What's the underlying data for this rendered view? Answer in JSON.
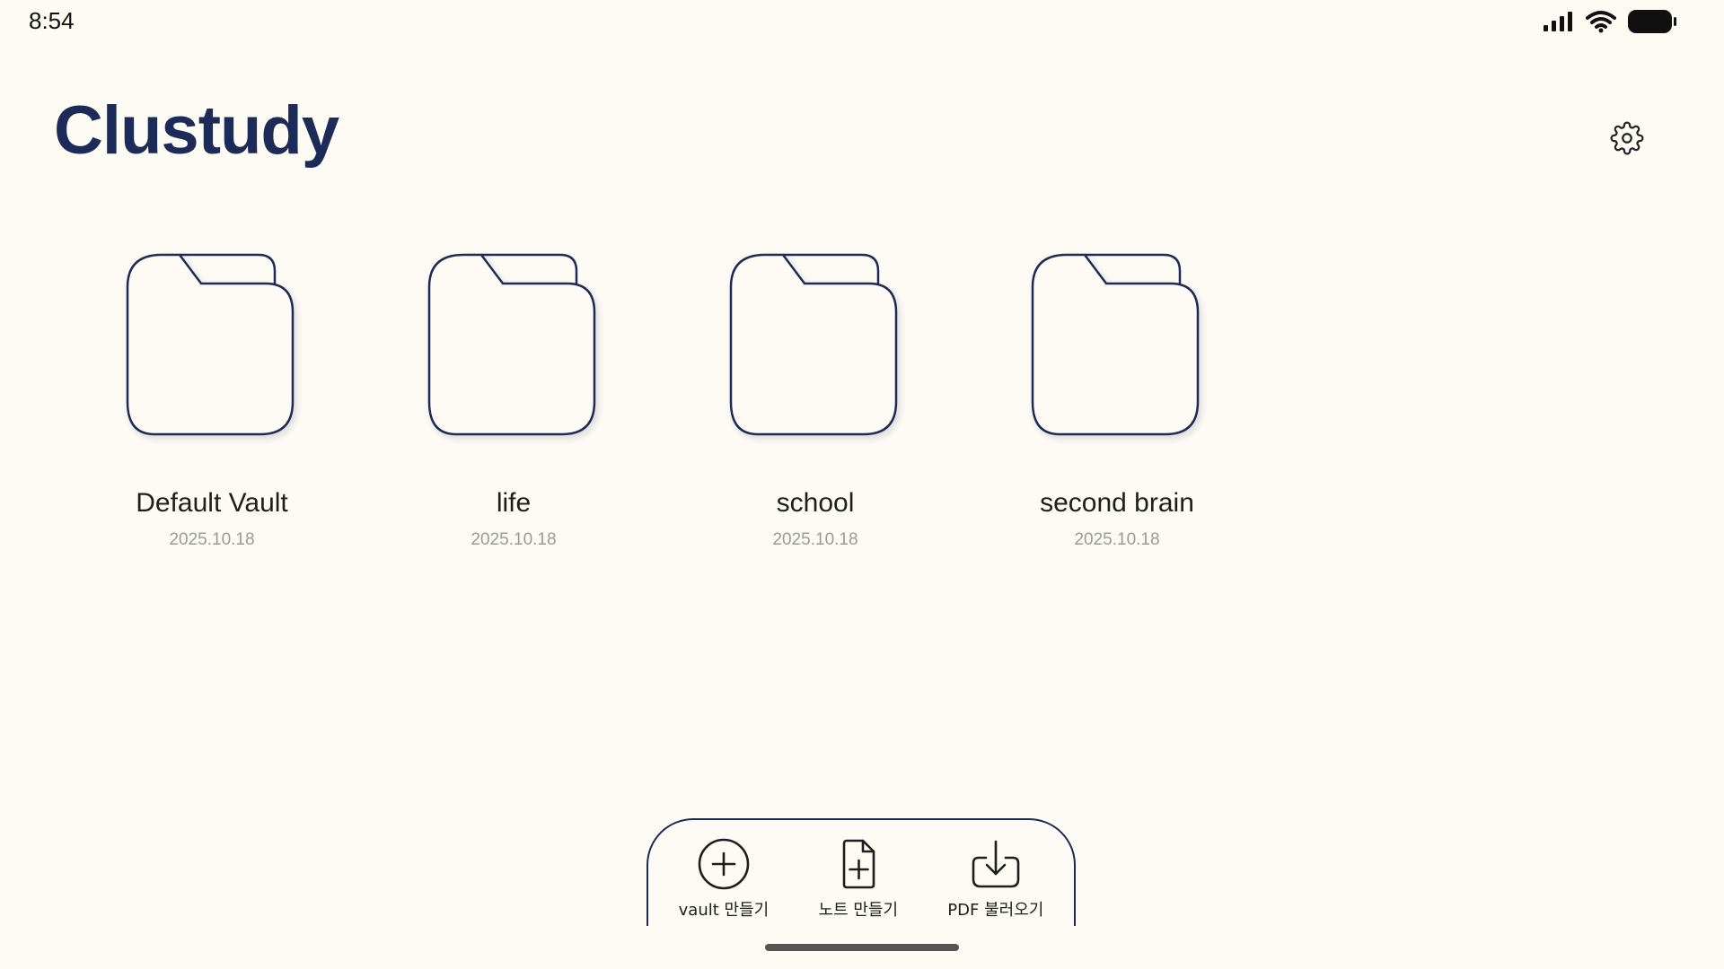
{
  "status_bar": {
    "time": "8:54",
    "icons": [
      "cellular-signal-icon",
      "wifi-icon",
      "battery-icon"
    ]
  },
  "header": {
    "title": "Clustudy",
    "settings_icon": "gear-icon"
  },
  "vaults": [
    {
      "name": "Default Vault",
      "date": "2025.10.18"
    },
    {
      "name": "life",
      "date": "2025.10.18"
    },
    {
      "name": "school",
      "date": "2025.10.18"
    },
    {
      "name": "second brain",
      "date": "2025.10.18"
    }
  ],
  "action_bar": {
    "create_vault": {
      "label": "vault 만들기",
      "icon": "plus-circle-icon"
    },
    "create_note": {
      "label": "노트 만들기",
      "icon": "file-plus-icon"
    },
    "import_pdf": {
      "label": "PDF 불러오기",
      "icon": "download-icon"
    }
  },
  "colors": {
    "background": "#fdfbf4",
    "accent": "#1c2b57",
    "text": "#1e1e1e",
    "muted": "#9a9a9a"
  }
}
